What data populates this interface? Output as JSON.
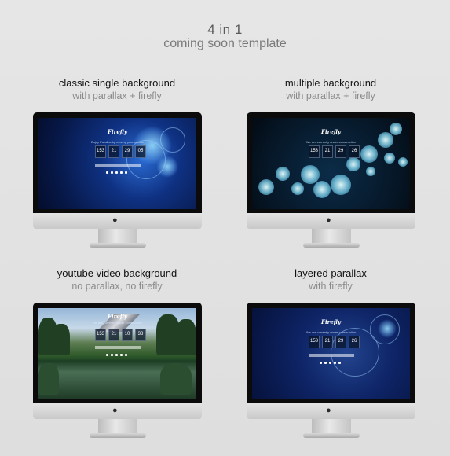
{
  "header": {
    "line1": "4 in 1",
    "line2": "coming soon template"
  },
  "cards": [
    {
      "title": "classic single background",
      "subtitle": "with parallax + firefly",
      "screen": {
        "logo": "Firefly",
        "tagline": "Enjoy Parallax by moving your mouse",
        "counters": [
          "153",
          "21",
          "29",
          "05"
        ]
      }
    },
    {
      "title": "multiple background",
      "subtitle": "with parallax + firefly",
      "screen": {
        "logo": "Firefly",
        "tagline": "We are currently under construction",
        "counters": [
          "153",
          "21",
          "29",
          "26"
        ]
      }
    },
    {
      "title": "youtube video background",
      "subtitle": "no parallax, no firefly",
      "screen": {
        "logo": "Firefly",
        "tagline": "We are currently under construction",
        "counters": [
          "153",
          "21",
          "10",
          "38"
        ]
      }
    },
    {
      "title": "layered parallax",
      "subtitle": "with firefly",
      "screen": {
        "logo": "Firefly",
        "tagline": "We are currently under construction",
        "counters": [
          "153",
          "21",
          "29",
          "26"
        ]
      }
    }
  ],
  "icons": {
    "device": "apple-logo-icon",
    "social": "social-icons"
  }
}
